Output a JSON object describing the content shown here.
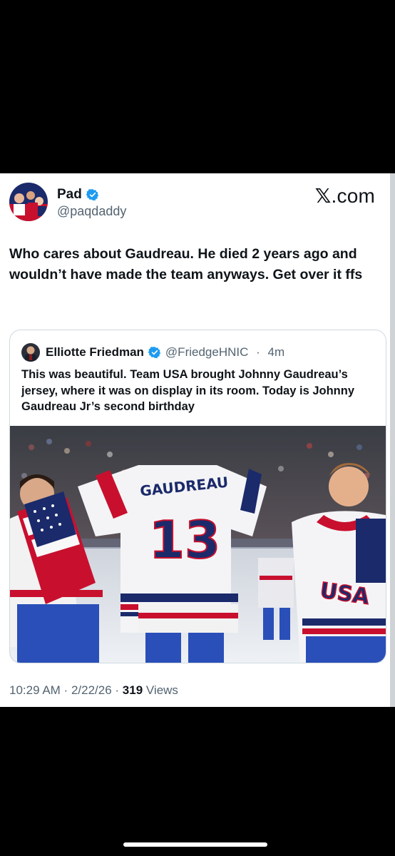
{
  "post": {
    "display_name": "Pad",
    "handle": "@paqdaddy",
    "brand": ".com",
    "brand_mark": "𝕏",
    "text": "Who cares about Gaudreau. He died 2 years ago and wouldn’t have made the team anyways. Get over it ffs",
    "time": "10:29 AM",
    "sep1": " · ",
    "date": "2/22/26",
    "sep2": " · ",
    "views_count": "319",
    "views_label": " Views",
    "verified_icon": "verified-badge-icon",
    "accent": "#1d9bf0"
  },
  "quote": {
    "display_name": "Elliotte Friedman",
    "handle": "@FriedgeHNIC",
    "sep": " · ",
    "age": "4m",
    "text": "This was beautiful. Team USA brought Johnny Gaudreau’s jersey, where it was on display in its room. Today is Johnny Gaudreau Jr’s second birthday",
    "photo": {
      "jersey_name": "GAUDREAU",
      "jersey_number": "13",
      "usa_label": "USA"
    }
  }
}
